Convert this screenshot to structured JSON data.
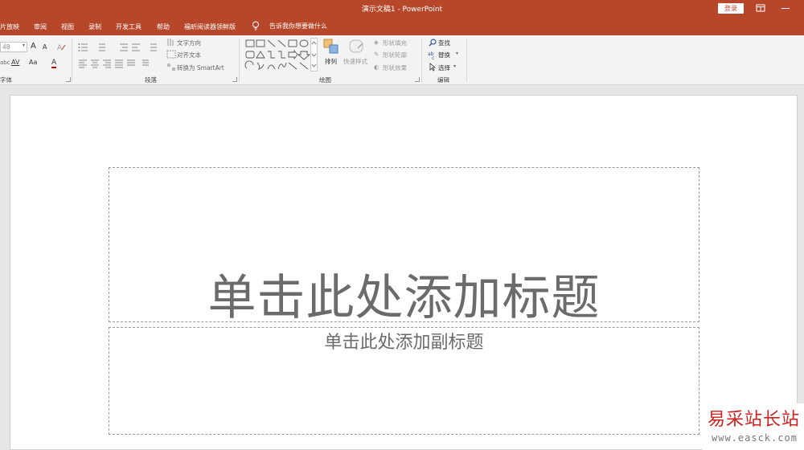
{
  "titlebar": {
    "title": "演示文稿1  -  PowerPoint",
    "login_label": "登录"
  },
  "tabs": [
    {
      "label": "片放映"
    },
    {
      "label": "审阅"
    },
    {
      "label": "视图"
    },
    {
      "label": "录制"
    },
    {
      "label": "开发工具"
    },
    {
      "label": "帮助"
    },
    {
      "label": "福昕阅读器领鲜版"
    }
  ],
  "tellme": {
    "label": "告诉我你想要做什么"
  },
  "ribbon": {
    "font": {
      "group_label": "字体",
      "size_value": "48",
      "grow_label": "A",
      "shrink_label": "A",
      "abc_label": "abc",
      "spacing_label": "AV",
      "case_label": "Aa",
      "color_label": "A"
    },
    "paragraph": {
      "group_label": "段落",
      "text_direction": "文字方向",
      "align_text": "对齐文本",
      "smartart": "转换为 SmartArt"
    },
    "drawing": {
      "group_label": "绘图",
      "arrange": "排列",
      "quick_styles": "快速样式",
      "shape_fill": "形状填充",
      "shape_outline": "形状轮廓",
      "shape_effects": "形状效果"
    },
    "editing": {
      "group_label": "编辑",
      "find": "查找",
      "replace": "替换",
      "select": "选择"
    }
  },
  "slide": {
    "title_placeholder": "单击此处添加标题",
    "subtitle_placeholder": "单击此处添加副标题"
  },
  "watermark": {
    "main": "易采站长站",
    "url": "www.easck.com"
  },
  "colors": {
    "accent": "#b7472a",
    "ribbon_bg": "#f3f3f3",
    "workspace_bg": "#e6e6e6",
    "placeholder_text": "#6b6b6b",
    "watermark_red": "#cc2222"
  }
}
